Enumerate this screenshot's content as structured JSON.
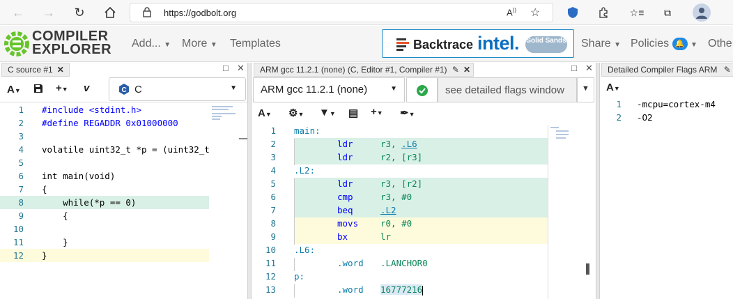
{
  "browser": {
    "url": "https://godbolt.org",
    "icons": [
      "back-icon",
      "forward-icon",
      "refresh-icon",
      "home-icon",
      "lock-icon",
      "read-aloud-icon",
      "add-favorite-icon",
      "shield-icon",
      "extensions-icon",
      "favorites-icon",
      "collections-icon",
      "profile-icon"
    ]
  },
  "header": {
    "logo_line1": "COMPILER",
    "logo_line2": "EXPLORER",
    "add_label": "Add...",
    "more_label": "More",
    "templates_label": "Templates",
    "share_label": "Share",
    "policies_label": "Policies",
    "other_label": "Othe",
    "sponsor": {
      "backtrace": "Backtrace",
      "intel": "intel.",
      "solid": "Solid Sands"
    }
  },
  "source_pane": {
    "tab_title": "C source #1",
    "language": "C",
    "lines": [
      {
        "n": "1",
        "text": "#include <stdint.h>"
      },
      {
        "n": "2",
        "text": "#define REGADDR 0x01000000"
      },
      {
        "n": "3",
        "text": ""
      },
      {
        "n": "4",
        "text": "volatile uint32_t *p = (uint32_t"
      },
      {
        "n": "5",
        "text": ""
      },
      {
        "n": "6",
        "text": "int main(void)"
      },
      {
        "n": "7",
        "text": "{"
      },
      {
        "n": "8",
        "text": "    while(*p == 0)"
      },
      {
        "n": "9",
        "text": "    {"
      },
      {
        "n": "10",
        "text": ""
      },
      {
        "n": "11",
        "text": "    }"
      },
      {
        "n": "12",
        "text": "}"
      }
    ]
  },
  "compiler_pane": {
    "tab_title": "ARM gcc 11.2.1 (none) (C, Editor #1, Compiler #1)",
    "compiler": "ARM gcc 11.2.1 (none)",
    "flags_placeholder": "see detailed flags window",
    "asm": [
      {
        "n": "1",
        "label": "main:"
      },
      {
        "n": "2",
        "op": "ldr",
        "args": "r3, ",
        "link": ".L6",
        "rest": ""
      },
      {
        "n": "3",
        "op": "ldr",
        "args": "r2, [r3]"
      },
      {
        "n": "4",
        "label": ".L2:"
      },
      {
        "n": "5",
        "op": "ldr",
        "args": "r3, [r2]"
      },
      {
        "n": "6",
        "op": "cmp",
        "args": "r3, #0"
      },
      {
        "n": "7",
        "op": "beq",
        "args": "",
        "link": ".L2"
      },
      {
        "n": "8",
        "op": "movs",
        "args": "r0, #0"
      },
      {
        "n": "9",
        "op": "bx",
        "args": "lr"
      },
      {
        "n": "10",
        "label": ".L6:"
      },
      {
        "n": "11",
        "op": ".word",
        "args": ".LANCHOR0"
      },
      {
        "n": "12",
        "label": "p:"
      },
      {
        "n": "13",
        "op": ".word",
        "args": "16777216"
      }
    ]
  },
  "flags_pane": {
    "tab_title": "Detailed Compiler Flags ARM",
    "lines": [
      {
        "n": "1",
        "text": "-mcpu=cortex-m4"
      },
      {
        "n": "2",
        "text": "-O2"
      }
    ]
  }
}
